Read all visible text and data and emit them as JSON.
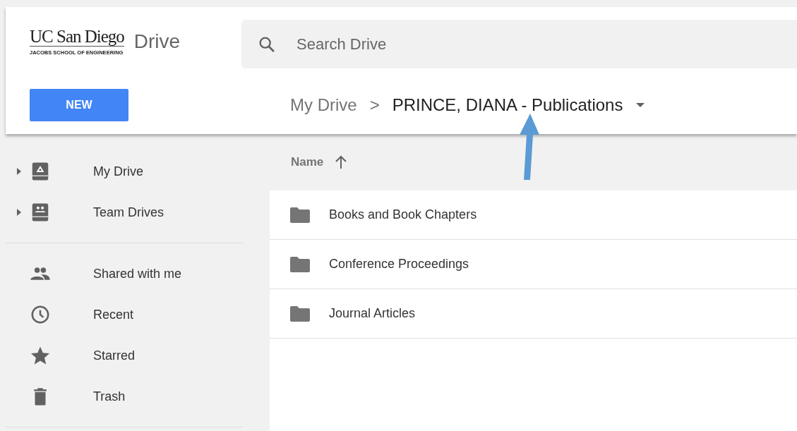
{
  "header": {
    "logo": {
      "name": "UC San Diego",
      "subtitle": "JACOBS SCHOOL OF ENGINEERING"
    },
    "app_name": "Drive",
    "search": {
      "placeholder": "Search Drive"
    }
  },
  "new_button": "NEW",
  "breadcrumb": {
    "parent": "My Drive",
    "separator": ">",
    "current": "PRINCE, DIANA - Publications"
  },
  "sidebar": {
    "groups": [
      [
        {
          "label": "My Drive",
          "kind": "drive",
          "expandable": true
        },
        {
          "label": "Team Drives",
          "kind": "team",
          "expandable": true
        }
      ],
      [
        {
          "label": "Shared with me",
          "kind": "people",
          "expandable": false
        },
        {
          "label": "Recent",
          "kind": "clock",
          "expandable": false
        },
        {
          "label": "Starred",
          "kind": "star",
          "expandable": false
        },
        {
          "label": "Trash",
          "kind": "trash",
          "expandable": false
        }
      ]
    ]
  },
  "file_list": {
    "sort_column": "Name",
    "rows": [
      {
        "name": "Books and Book Chapters",
        "kind": "folder"
      },
      {
        "name": "Conference Proceedings",
        "kind": "folder"
      },
      {
        "name": "Journal Articles",
        "kind": "folder"
      }
    ]
  }
}
